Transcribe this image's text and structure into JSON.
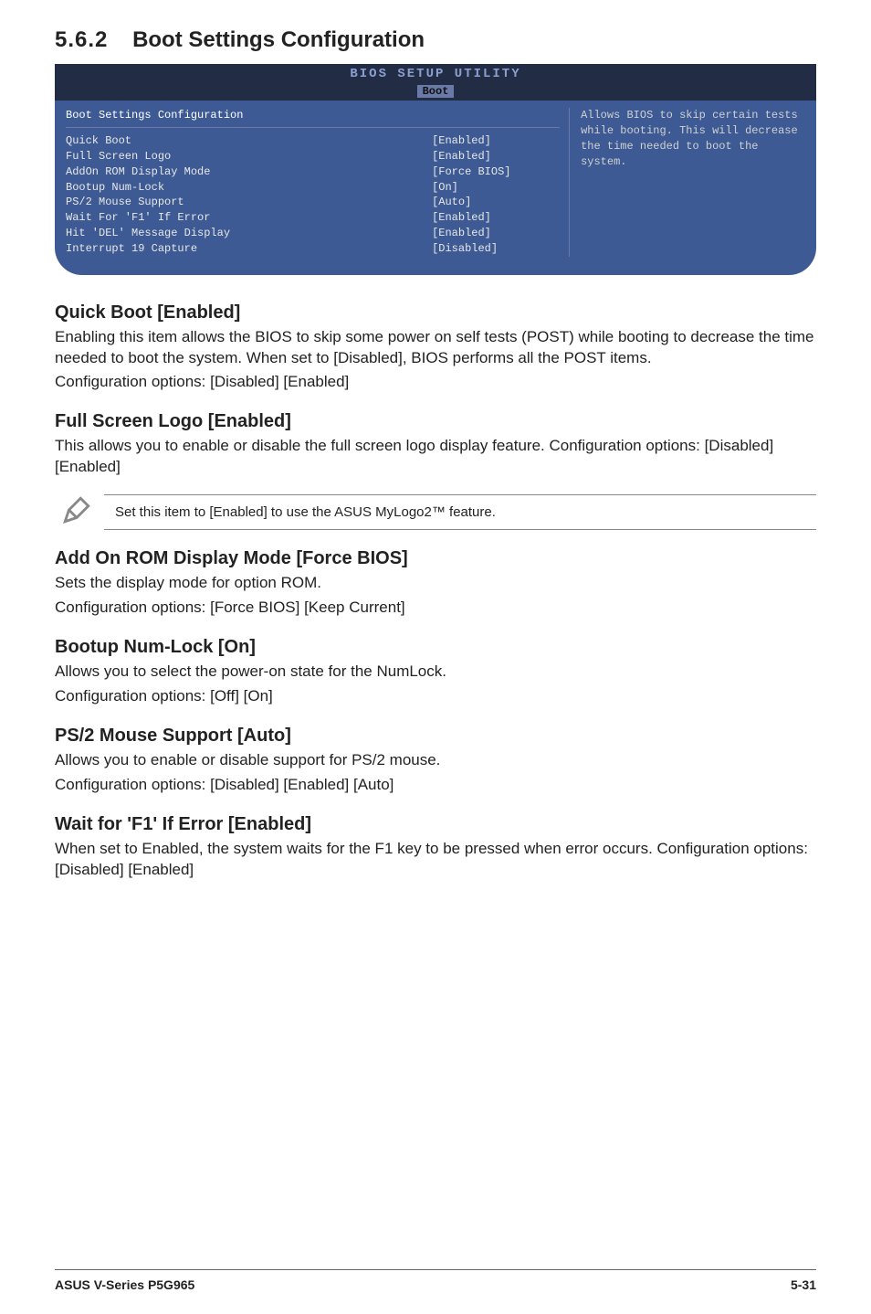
{
  "section": {
    "number": "5.6.2",
    "title": "Boot Settings Configuration"
  },
  "bios": {
    "header": "BIOS SETUP UTILITY",
    "tab": "Boot",
    "panel_title": "Boot Settings Configuration",
    "rows": [
      {
        "key": "Quick Boot",
        "val": "[Enabled]"
      },
      {
        "key": "Full Screen Logo",
        "val": "[Enabled]"
      },
      {
        "key": "AddOn ROM Display Mode",
        "val": "[Force BIOS]"
      },
      {
        "key": "Bootup Num-Lock",
        "val": "[On]"
      },
      {
        "key": "PS/2 Mouse Support",
        "val": "[Auto]"
      },
      {
        "key": "Wait For 'F1' If Error",
        "val": "[Enabled]"
      },
      {
        "key": "Hit 'DEL' Message Display",
        "val": "[Enabled]"
      },
      {
        "key": "Interrupt 19 Capture",
        "val": "[Disabled]"
      }
    ],
    "help": "Allows BIOS to skip certain tests while booting. This will decrease the time needed to boot the system."
  },
  "options": [
    {
      "heading": "Quick Boot [Enabled]",
      "body": "Enabling this item allows the BIOS to skip some power on self tests (POST) while booting to decrease the time needed to boot the system. When set to [Disabled], BIOS performs all the POST items.",
      "config": "Configuration options: [Disabled] [Enabled]"
    },
    {
      "heading": "Full Screen Logo [Enabled]",
      "body": "This allows you to enable or disable the full screen logo display feature. Configuration options: [Disabled] [Enabled]"
    }
  ],
  "note": "Set this item to [Enabled] to use the ASUS MyLogo2™ feature.",
  "options2": [
    {
      "heading": "Add On ROM Display Mode [Force BIOS]",
      "body": "Sets the display mode for option ROM.",
      "config": "Configuration options: [Force BIOS] [Keep Current]"
    },
    {
      "heading": "Bootup Num-Lock [On]",
      "body": "Allows you to select the power-on state for the NumLock.",
      "config": "Configuration options: [Off] [On]"
    },
    {
      "heading": "PS/2 Mouse Support [Auto]",
      "body": "Allows you to enable or disable support for PS/2 mouse.",
      "config": "Configuration options: [Disabled] [Enabled] [Auto]"
    },
    {
      "heading": "Wait for 'F1' If Error [Enabled]",
      "body": "When set to Enabled, the system waits for the F1 key to be pressed when error occurs. Configuration options: [Disabled] [Enabled]"
    }
  ],
  "footer": {
    "left": "ASUS V-Series P5G965",
    "right": "5-31"
  }
}
